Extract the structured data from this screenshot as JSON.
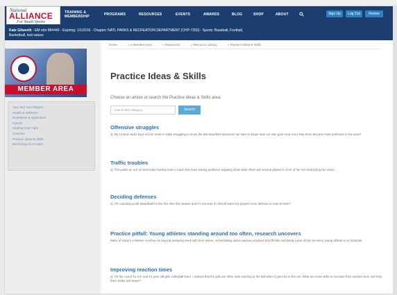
{
  "nav": {
    "logo": {
      "line1": "National",
      "line2": "ALLIANCE",
      "line3": "For Youth Sports"
    },
    "items": [
      "TRAINING &",
      "PROGRAMS",
      "RESOURCES",
      "EVENTS",
      "AWARDS",
      "BLOG",
      "SHOP",
      "ABOUT"
    ],
    "item_sub": "MEMBERSHIP",
    "buttons": [
      "Sign Up",
      "Log Out",
      "Renew"
    ],
    "search_icon": "search-icon"
  },
  "member": {
    "name": "Kate Gilworth",
    "details": " - EM mbr 884440 - Expiring: 1/1/2016 - Chapter: NATL PARKS & RECREATION DEPARTMENT (CHP-7250) - Sports: Baseball, Football,",
    "details2": "Basketball, test values"
  },
  "sidebar": {
    "banner": "MEMBER AREA",
    "links": [
      "Your and Your Players",
      "Health & Wellness",
      "Guidelines & Application",
      "Injuries",
      "Starting Your Fight",
      "Coaches",
      "Practice Ideas & Skills",
      "Becoming as a Coach"
    ]
  },
  "main": {
    "breadcrumb": [
      "Home",
      "» A Member Area",
      "» Resources",
      "» Resource Library",
      "» Practice Ideas & Skills"
    ],
    "title": "Practice Ideas & Skills",
    "intro": "Choose an article or search the Practice Ideas & Skills area:",
    "search_placeholder": "search this category",
    "search_button": "Search",
    "articles": [
      {
        "title": "Offensive struggles",
        "excerpt": "Q: My 13-and-under boys soccer team is really struggling to move the ball downfield whenever we have to begin near our own goal. How can I help them become more proficient in this area?"
      },
      {
        "title": "Traffic troubles",
        "excerpt": "Q: The goalie on our 12-and-under hockey team I coach has been having problems stopping shots when there are several players in front of her net obstructing her vision."
      },
      {
        "title": "Deciding defenses",
        "excerpt": "Q: I'm coaching youth basketball for the first time this season and I'm not sure if I should teach my players zone defense or man-to-man?"
      },
      {
        "title": "Practice pitfall: Young athletes standing around too often, research uncovers",
        "excerpt": "Many of today's volunteer coaches do beyond analyzing work with their teams, orchestrating action-packed practices that fill kids and being a part of but not every young athlete is so fortunate."
      },
      {
        "title": "Improving reaction times",
        "excerpt": "Q: I'm the coach for a 9- and 10-year-old girls volleyball team. I noticed that the girls are often slow reacting to the ball when it goes for to the net. What are some drills to increase their reaction time and help them make sell saves?"
      }
    ]
  }
}
